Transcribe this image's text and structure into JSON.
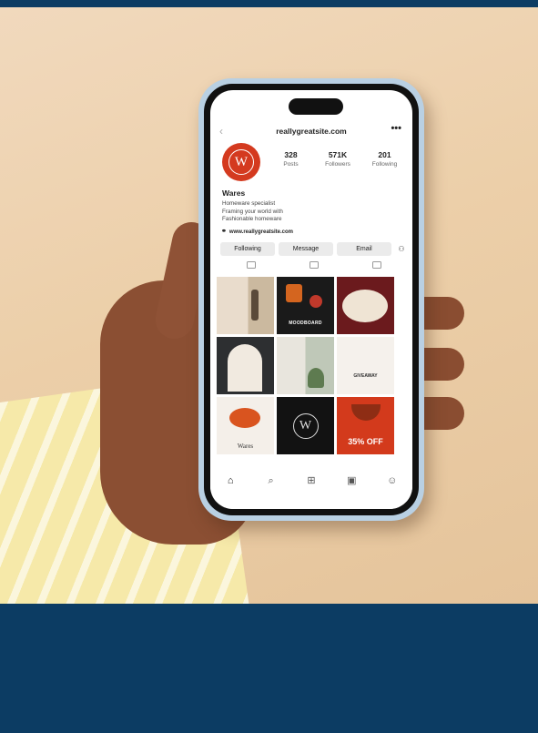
{
  "profile": {
    "site": "reallygreatsite.com",
    "avatar_letter": "W",
    "stats": [
      {
        "value": "328",
        "label": "Posts"
      },
      {
        "value": "571K",
        "label": "Followers"
      },
      {
        "value": "201",
        "label": "Following"
      }
    ],
    "name": "Wares",
    "bio": [
      "Homeware specialist",
      "Framing your world with",
      "Fashionable homeware"
    ],
    "link": "www.reallygreatsite.com"
  },
  "actions": {
    "following": "Following",
    "message": "Message",
    "email": "Email"
  },
  "tiles": {
    "moodboard": "MOODBOARD",
    "giveaway": "GIVEAWAY",
    "wares": "Wares",
    "w_logo": "W",
    "sale": "35% OFF"
  },
  "icons": {
    "back": "‹",
    "more": "•••",
    "chain": "⚭",
    "add_user": "⚇",
    "home": "⌂",
    "search": "⌕",
    "add": "⊞",
    "reels": "▣",
    "profile": "☺"
  },
  "colors": {
    "brand": "#d43a1f",
    "frame": "#0c3c63"
  }
}
